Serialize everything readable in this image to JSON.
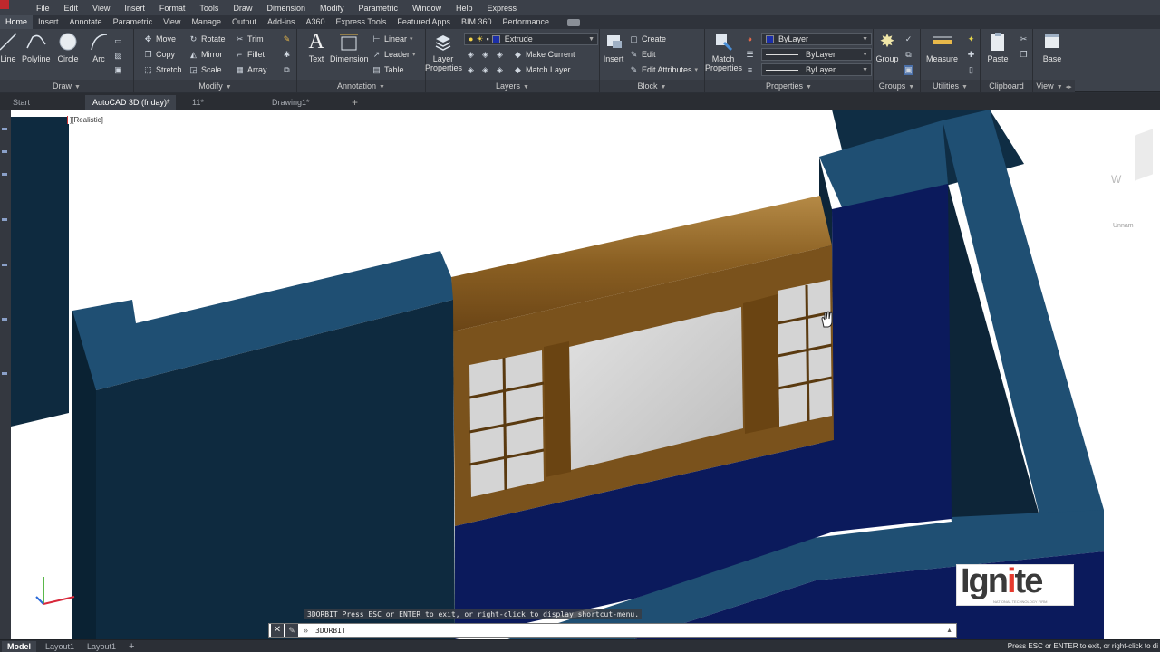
{
  "menu": [
    "File",
    "Edit",
    "View",
    "Insert",
    "Format",
    "Tools",
    "Draw",
    "Dimension",
    "Modify",
    "Parametric",
    "Window",
    "Help",
    "Express"
  ],
  "ribbon_tabs": [
    "Home",
    "Insert",
    "Annotate",
    "Parametric",
    "View",
    "Manage",
    "Output",
    "Add-ins",
    "A360",
    "Express Tools",
    "Featured Apps",
    "BIM 360",
    "Performance"
  ],
  "draw": {
    "title": "Draw",
    "line": "Line",
    "polyline": "Polyline",
    "circle": "Circle",
    "arc": "Arc"
  },
  "modify": {
    "title": "Modify",
    "move": "Move",
    "rotate": "Rotate",
    "trim": "Trim",
    "copy": "Copy",
    "mirror": "Mirror",
    "fillet": "Fillet",
    "stretch": "Stretch",
    "scale": "Scale",
    "array": "Array"
  },
  "annotation": {
    "title": "Annotation",
    "text": "Text",
    "dimension": "Dimension",
    "linear": "Linear",
    "leader": "Leader",
    "table": "Table"
  },
  "layers": {
    "title": "Layers",
    "layer_properties": "Layer Properties",
    "current_layer": "Extrude",
    "make_current": "Make Current",
    "match_layer": "Match Layer"
  },
  "block": {
    "title": "Block",
    "insert": "Insert",
    "create": "Create",
    "edit": "Edit",
    "edit_attributes": "Edit Attributes"
  },
  "properties": {
    "title": "Properties",
    "match_properties": "Match Properties",
    "color": "ByLayer",
    "linetype": "ByLayer",
    "lineweight": "ByLayer"
  },
  "groups": {
    "title": "Groups",
    "group": "Group"
  },
  "utilities": {
    "title": "Utilities",
    "measure": "Measure"
  },
  "clipboard": {
    "title": "Clipboard",
    "paste": "Paste"
  },
  "view_panel": {
    "title": "View",
    "base": "Base"
  },
  "doc_tabs": [
    "Start",
    "AutoCAD 3D (friday)*",
    "11*",
    "Drawing1*"
  ],
  "viewport": {
    "label": "][Realistic]",
    "viewcube_letter": "W",
    "viewcube_label": "Unnam"
  },
  "command": {
    "history": "3DORBIT Press ESC or ENTER to exit, or right-click to display shortcut-menu.",
    "current": "3DORBIT",
    "prompt": "»"
  },
  "logo": {
    "brand": "Ignite",
    "tagline": "NATIONAL TECHNOLOGY FIRM"
  },
  "layout_tabs": [
    "Model",
    "Layout1",
    "Layout1"
  ],
  "status_message": "Press ESC or ENTER to exit, or right-click to di",
  "colors": {
    "wall_top": "#1f4f73",
    "wall_side": "#0e2a3f",
    "wall_inner": "#0b1a5c",
    "wood": "#8a5f22",
    "brand_red": "#e63a2e"
  }
}
